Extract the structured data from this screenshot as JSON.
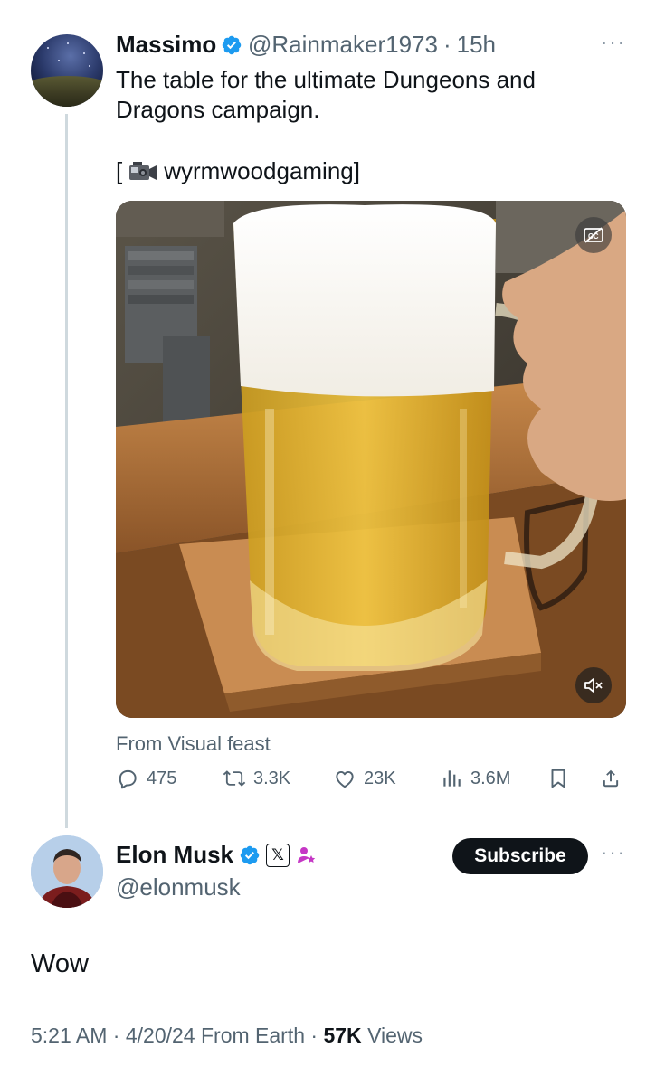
{
  "tweet": {
    "author_name": "Massimo",
    "handle": "@Rainmaker1973",
    "separator": "·",
    "time": "15h",
    "more_label": "···",
    "text": "The table for the ultimate Dungeons and Dragons campaign.",
    "embed_prefix": "[",
    "embed_name": "wyrmwoodgaming]",
    "source": "From Visual feast",
    "actions": {
      "replies": "475",
      "reposts": "3.3K",
      "likes": "23K",
      "views": "3.6M"
    }
  },
  "reply": {
    "author_name": "Elon Musk",
    "x_badge": "𝕏",
    "handle": "@elonmusk",
    "subscribe_label": "Subscribe",
    "more_label": "···",
    "text": "Wow",
    "time": "5:21 AM",
    "date": "4/20/24",
    "from": "From Earth",
    "views_count": "57K",
    "views_label": "Views"
  },
  "colors": {
    "verified": "#1d9bf0",
    "text_primary": "#0f1419",
    "text_secondary": "#536471",
    "affiliate_badge": "#c537c5"
  },
  "icons": [
    "verified-icon",
    "video-camera-icon",
    "captions-off-icon",
    "mute-icon",
    "reply-icon",
    "repost-icon",
    "like-icon",
    "views-icon",
    "bookmark-icon",
    "share-icon",
    "x-logo-icon",
    "affiliate-icon"
  ]
}
